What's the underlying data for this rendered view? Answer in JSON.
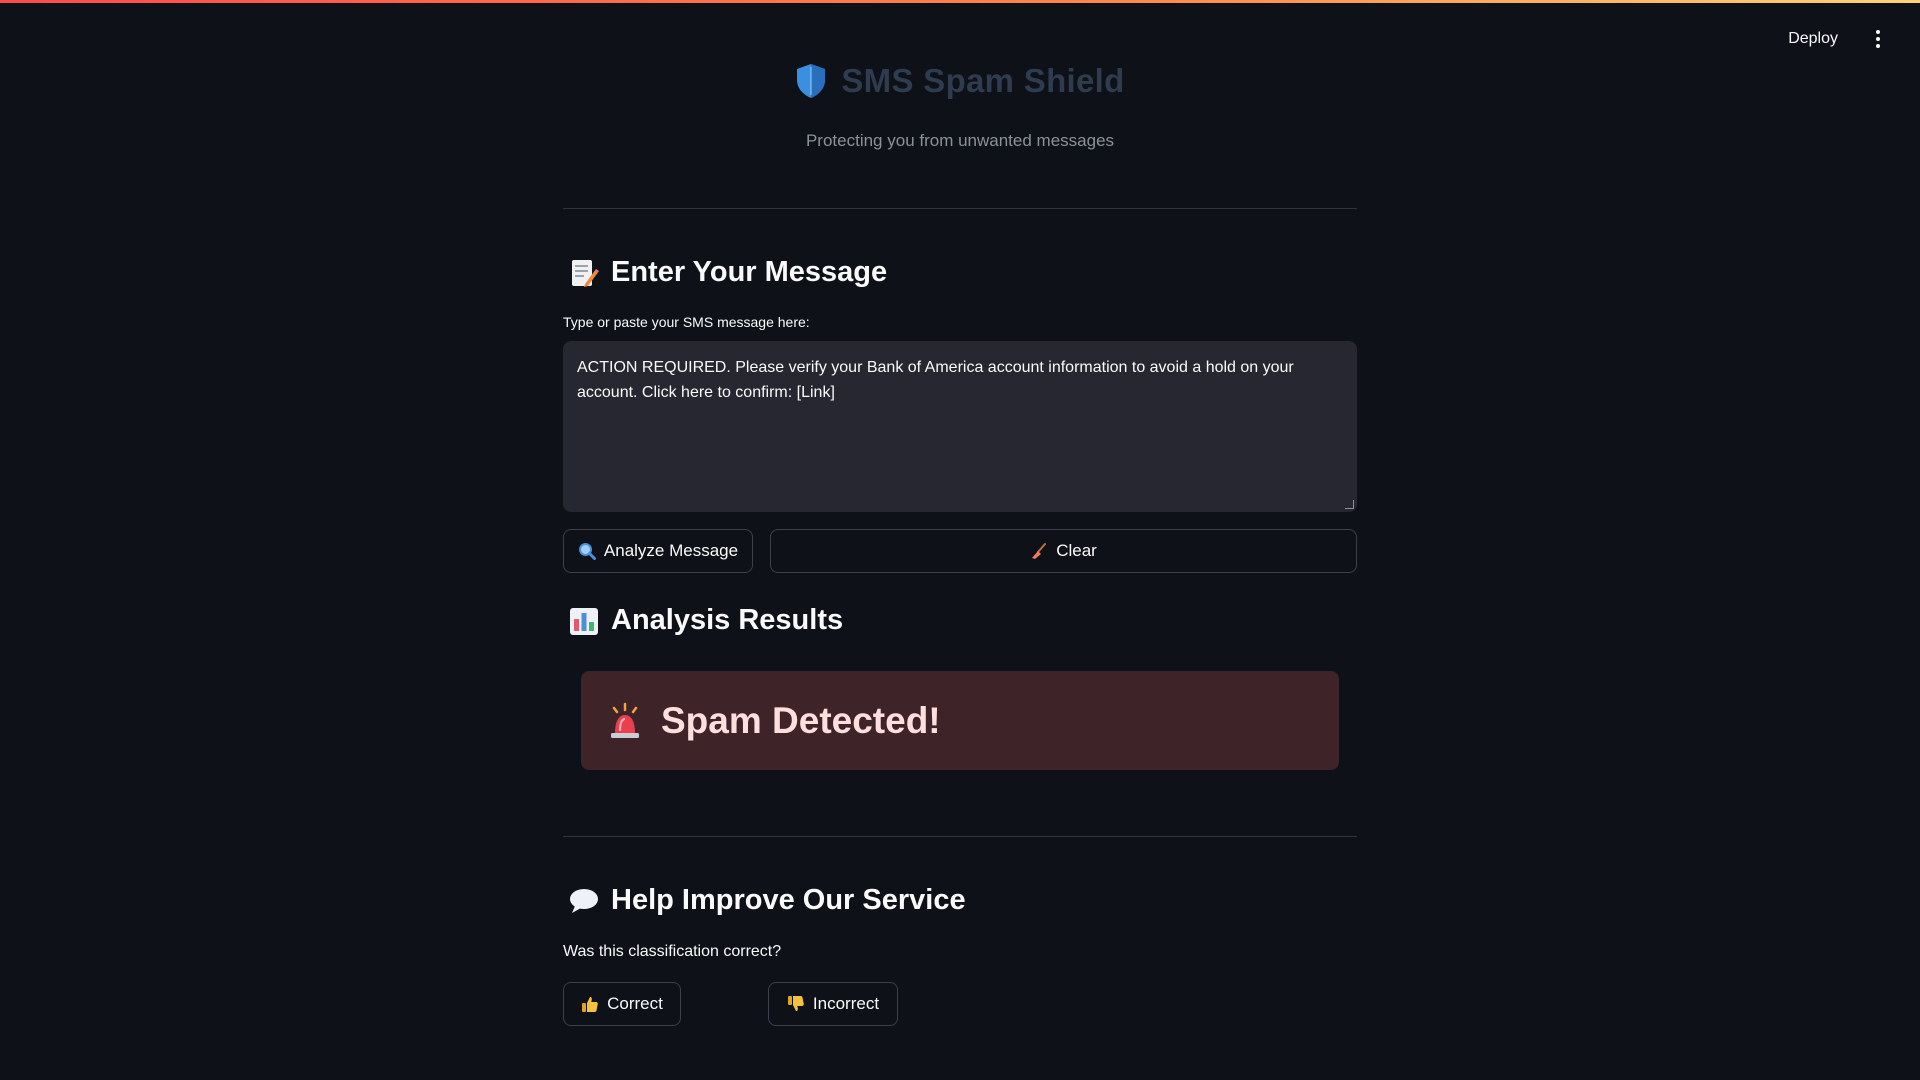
{
  "topbar": {
    "deploy_label": "Deploy",
    "menu_icon": "kebab-menu-icon"
  },
  "app": {
    "title": "SMS Spam Shield",
    "subtitle": "Protecting you from unwanted messages",
    "title_color": "#2f3b4e"
  },
  "input_section": {
    "heading": "Enter Your Message",
    "icon": "memo-icon",
    "label": "Type or paste your SMS message here:",
    "value": "ACTION REQUIRED. Please verify your Bank of America account information to avoid a hold on your account. Click here to confirm: [Link]"
  },
  "buttons": {
    "analyze": "Analyze Message",
    "analyze_icon": "magnifier-icon",
    "clear": "Clear",
    "clear_icon": "broom-icon"
  },
  "results": {
    "heading": "Analysis Results",
    "icon": "bar-chart-icon",
    "verdict": "Spam Detected!",
    "verdict_icon": "siren-icon",
    "verdict_bg": "#3e2329"
  },
  "feedback": {
    "heading": "Help Improve Our Service",
    "icon": "speech-balloon-icon",
    "question": "Was this classification correct?",
    "correct": "Correct",
    "correct_icon": "thumbs-up-icon",
    "incorrect": "Incorrect",
    "incorrect_icon": "thumbs-down-icon"
  },
  "colors": {
    "background": "#0e1117",
    "input_bg": "#262730",
    "accent_gradient_start": "#ff4b4b",
    "accent_gradient_end": "#ffd27a"
  }
}
